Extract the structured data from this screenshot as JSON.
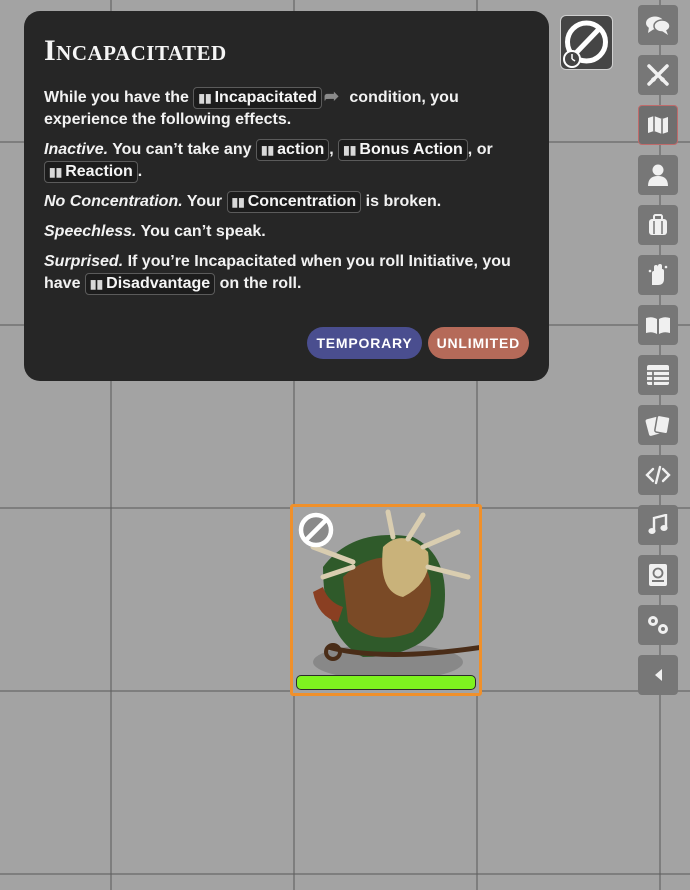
{
  "condition_card": {
    "title": "Incapacitated",
    "intro_prefix": "While you have the",
    "intro_chip": "Incapacitated",
    "intro_suffix": " condition, you experience the following effects.",
    "inactive_label": "Inactive.",
    "inactive_text": " You can’t take any ",
    "chip_action": "action",
    "comma_1": ", ",
    "chip_bonus": "Bonus Action",
    "comma_or": ", or",
    "chip_reaction": "Reaction",
    "period": ".",
    "noconc_label": "No Concentration.",
    "noconc_text": " Your ",
    "chip_concentration": "Concentration",
    "noconc_suffix": " is broken.",
    "speechless_label": "Speechless.",
    "speechless_text": " You can’t speak.",
    "surprised_label": "Surprised.",
    "surprised_text": " If you’re Incapacitated when you roll Initiative, you have ",
    "chip_disadvantage": "Disadvantage",
    "surprised_suffix": " on the roll.",
    "tag_temporary": "TEMPORARY",
    "tag_unlimited": "UNLIMITED"
  },
  "sidebar": {
    "items": [
      "chat-icon",
      "combat-icon",
      "map-icon",
      "actor-icon",
      "items-icon",
      "journal-hand-icon",
      "compendium-book-icon",
      "tables-icon",
      "cards-icon",
      "macros-icon",
      "playlists-icon",
      "compendium-icon",
      "settings-icon",
      "collapse-icon"
    ]
  },
  "token": {
    "status": "incapacitated-icon",
    "hp_fraction": 1.0
  },
  "colors": {
    "card_bg": "#262626",
    "temporary": "#4a4e8f",
    "unlimited": "#b56a59",
    "hp": "#7ef31f",
    "token_border": "#f0902a"
  }
}
